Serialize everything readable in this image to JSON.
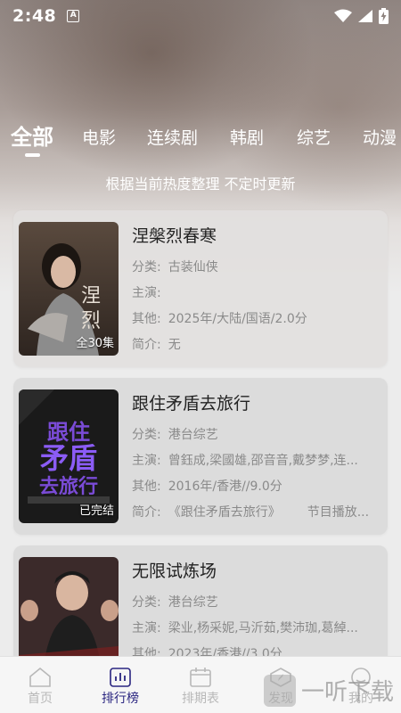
{
  "status_bar": {
    "time": "2:48",
    "notification_icon": "A",
    "icons": [
      "wifi-icon",
      "signal-icon",
      "battery-charging-icon"
    ]
  },
  "tabs": [
    {
      "label": "全部",
      "active": true
    },
    {
      "label": "电影",
      "active": false
    },
    {
      "label": "连续剧",
      "active": false
    },
    {
      "label": "韩剧",
      "active": false
    },
    {
      "label": "综艺",
      "active": false
    },
    {
      "label": "动漫",
      "active": false
    }
  ],
  "subtitle": "根据当前热度整理 不定时更新",
  "cards": [
    {
      "title": "涅槃烈春寒",
      "badge": "全30集",
      "poster_text": "涅槃烈春寒",
      "category_label": "分类:",
      "category": "古装仙侠",
      "cast_label": "主演:",
      "cast": "",
      "other_label": "其他:",
      "other": "2025年/大陆/国语/2.0分",
      "intro_label": "简介:",
      "intro": "无",
      "intro_extra": ""
    },
    {
      "title": "跟住矛盾去旅行",
      "badge": "已完结",
      "poster_text": "跟住矛盾去旅行",
      "category_label": "分类:",
      "category": "港台综艺",
      "cast_label": "主演:",
      "cast": "曾鈺成,梁國雄,邵音音,戴梦梦,连...",
      "other_label": "其他:",
      "other": "2016年/香港//9.0分",
      "intro_label": "简介:",
      "intro": "《跟住矛盾去旅行》",
      "intro_extra": "节目播放..."
    },
    {
      "title": "无限试炼场",
      "badge": "",
      "poster_text": "",
      "category_label": "分类:",
      "category": "港台综艺",
      "cast_label": "主演:",
      "cast": "梁业,杨采妮,马沂茹,樊沛珈,葛綽...",
      "other_label": "其他:",
      "other": "2023年/香港//3.0分",
      "intro_label": "",
      "intro": "",
      "intro_extra": ""
    }
  ],
  "bottom_nav": [
    {
      "label": "首页",
      "icon": "home-icon",
      "active": false
    },
    {
      "label": "排行榜",
      "icon": "chart-icon",
      "active": true
    },
    {
      "label": "排期表",
      "icon": "calendar-icon",
      "active": false
    },
    {
      "label": "发现",
      "icon": "compass-icon",
      "active": false
    },
    {
      "label": "我的",
      "icon": "user-icon",
      "active": false
    }
  ],
  "watermark": "一听下载",
  "colors": {
    "accent": "#2a2580",
    "inactive": "#b8b8b8"
  }
}
